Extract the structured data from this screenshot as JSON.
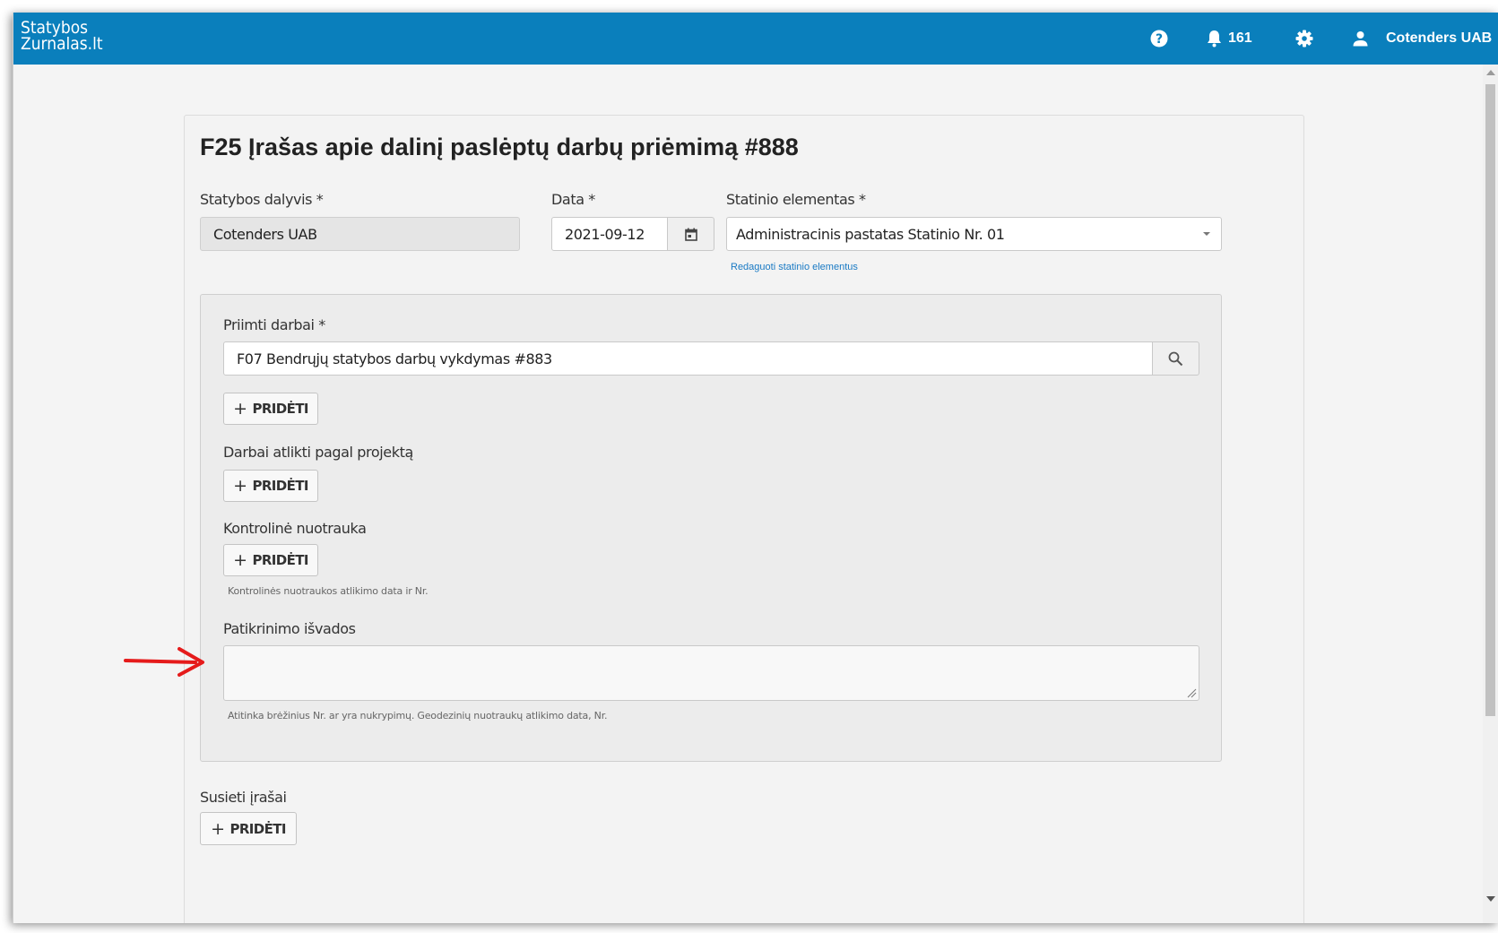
{
  "app": {
    "logo_line1": "Statybos",
    "logo_line2": "Zurnalas.lt",
    "notifications_count": "161",
    "user_name": "Cotenders UAB"
  },
  "icons": {
    "help": "help-circle-icon",
    "bell": "bell-icon",
    "gear": "gear-icon",
    "user": "user-icon",
    "calendar": "calendar-icon",
    "search": "search-icon"
  },
  "colors": {
    "topbar": "#0a7fbc",
    "link": "#1a7ac4",
    "annotation_arrow": "#e51b1b"
  },
  "form": {
    "title": "F25 Įrašas apie dalinį paslėptų darbų priėmimą #888",
    "participant_label": "Statybos dalyvis *",
    "participant_value": "Cotenders UAB",
    "date_label": "Data *",
    "date_value": "2021-09-12",
    "element_label": "Statinio elementas *",
    "element_value": "Administracinis pastatas Statinio Nr. 01",
    "edit_elements_link": "Redaguoti statinio elementus",
    "accepted_works_label": "Priimti darbai *",
    "accepted_works_value": "F07 Bendrųjų statybos darbų vykdymas #883",
    "add_label": "PRIDĖTI",
    "by_project_label": "Darbai atlikti pagal projektą",
    "control_photo_label": "Kontrolinė nuotrauka",
    "control_photo_hint": "Kontrolinės nuotraukos atlikimo data ir Nr.",
    "conclusions_label": "Patikrinimo išvados",
    "conclusions_hint": "Atitinka brėžinius Nr. ar yra nukrypimų. Geodezinių nuotraukų atlikimo data, Nr.",
    "linked_label": "Susieti įrašai"
  }
}
